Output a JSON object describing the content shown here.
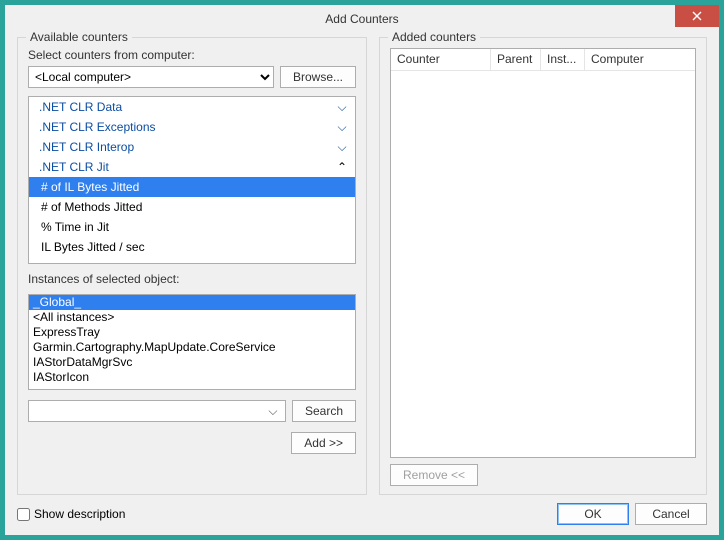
{
  "title": "Add Counters",
  "left": {
    "legend": "Available counters",
    "select_label": "Select counters from computer:",
    "computer_value": "<Local computer>",
    "browse_btn": "Browse...",
    "tree": [
      {
        "label": ".NET CLR Data",
        "expanded": false
      },
      {
        "label": ".NET CLR Exceptions",
        "expanded": false
      },
      {
        "label": ".NET CLR Interop",
        "expanded": false
      },
      {
        "label": ".NET CLR Jit",
        "expanded": true,
        "children": [
          {
            "label": "# of IL Bytes Jitted",
            "selected": true
          },
          {
            "label": "# of Methods Jitted"
          },
          {
            "label": "% Time in Jit"
          },
          {
            "label": "IL Bytes Jitted / sec"
          }
        ]
      }
    ],
    "instances_label": "Instances of selected object:",
    "instances": [
      {
        "label": "_Global_",
        "selected": true
      },
      {
        "label": "<All instances>"
      },
      {
        "label": "ExpressTray"
      },
      {
        "label": "Garmin.Cartography.MapUpdate.CoreService"
      },
      {
        "label": "IAStorDataMgrSvc"
      },
      {
        "label": "IAStorIcon"
      }
    ],
    "search_btn": "Search",
    "add_btn": "Add >>"
  },
  "right": {
    "legend": "Added counters",
    "columns": {
      "counter": "Counter",
      "parent": "Parent",
      "inst": "Inst...",
      "computer": "Computer"
    },
    "remove_btn": "Remove <<"
  },
  "footer": {
    "show_desc": "Show description",
    "ok": "OK",
    "cancel": "Cancel"
  }
}
